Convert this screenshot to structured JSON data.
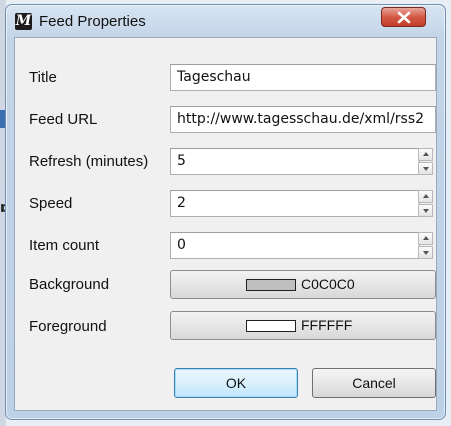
{
  "window": {
    "title": "Feed Properties",
    "app_icon_letter": "M"
  },
  "form": {
    "title_label": "Title",
    "title_value": "Tageschau",
    "feed_url_label": "Feed URL",
    "feed_url_value": "http://www.tagesschau.de/xml/rss2",
    "refresh_label": "Refresh (minutes)",
    "refresh_value": "5",
    "speed_label": "Speed",
    "speed_value": "2",
    "item_count_label": "Item count",
    "item_count_value": "0",
    "background_label": "Background",
    "background_value": "C0C0C0",
    "background_color": "#C0C0C0",
    "foreground_label": "Foreground",
    "foreground_value": "FFFFFF",
    "foreground_color": "#FFFFFF"
  },
  "buttons": {
    "ok": "OK",
    "cancel": "Cancel"
  },
  "icons": {
    "close": "close-icon",
    "spin_up": "spin-up-icon",
    "spin_down": "spin-down-icon"
  }
}
